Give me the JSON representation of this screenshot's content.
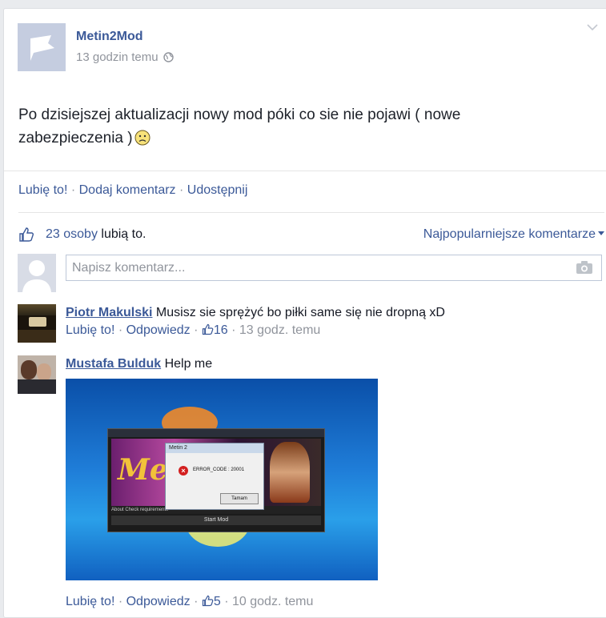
{
  "post": {
    "page_name": "Metin2Mod",
    "time": "13 godzin temu",
    "text": "Po dzisiejszej aktualizacji nowy mod póki co sie nie pojawi ( nowe zabezpieczenia )"
  },
  "actions": {
    "like": "Lubię to!",
    "sep": " · ",
    "comment": "Dodaj komentarz",
    "share": "Udostępnij"
  },
  "likes": {
    "count": "23 osoby",
    "suffix": " lubią to."
  },
  "sort_label": "Najpopularniejsze komentarze",
  "comment_input": {
    "placeholder": "Napisz komentarz..."
  },
  "comments": [
    {
      "author": "Piotr Makulski",
      "text": " Musisz sie sprężyć bo piłki same się nie dropną xD",
      "like": "Lubię to!",
      "reply": "Odpowiedz",
      "likes": "16",
      "time": "13 godz. temu"
    },
    {
      "author": "Mustafa Bulduk",
      "text": " Help me",
      "like": "Lubię to!",
      "reply": "Odpowiedz",
      "likes": "5",
      "time": "10 godz. temu"
    }
  ],
  "attachment": {
    "dialog_title": "Metin 2",
    "error_text": "ERROR_CODE : 20001",
    "button": "Tamam",
    "logo": "Me",
    "tabs": "About   Check requirements",
    "start": "Start Mod"
  },
  "colors": {
    "link": "#3b5998",
    "meta": "#90949c"
  }
}
